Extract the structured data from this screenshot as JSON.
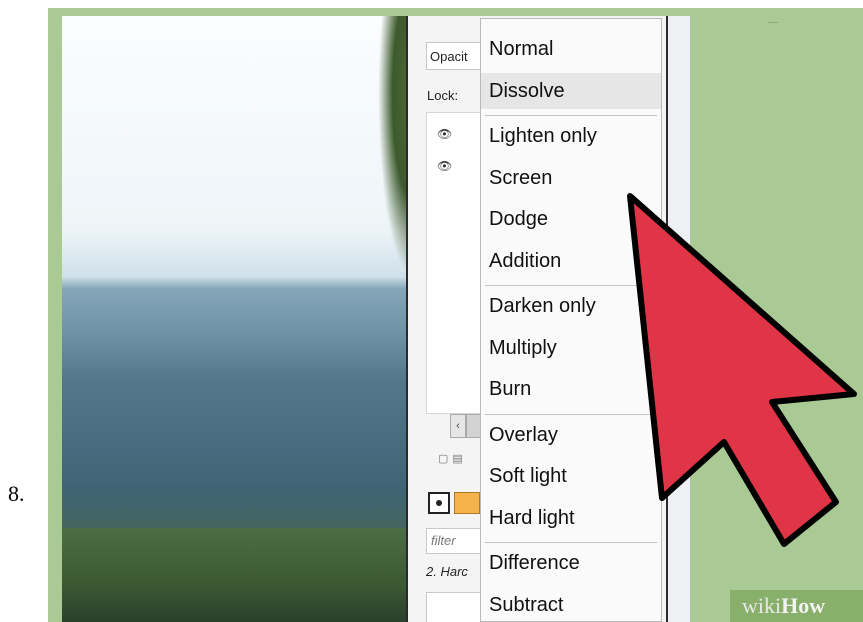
{
  "step_number": "8.",
  "layers_panel": {
    "opacity_label": "Opacit",
    "lock_label": "Lock:",
    "visibility_icons": [
      "eye-icon",
      "eye-icon"
    ],
    "filter_placeholder": "filter",
    "current_layer_name": "2. Harc",
    "fg_color": "#f6b34c",
    "scroll_left": "‹"
  },
  "blend_mode_menu": {
    "highlighted": "Dissolve",
    "groups": [
      [
        "Normal",
        "Dissolve"
      ],
      [
        "Lighten only",
        "Screen",
        "Dodge",
        "Addition"
      ],
      [
        "Darken only",
        "Multiply",
        "Burn"
      ],
      [
        "Overlay",
        "Soft light",
        "Hard light"
      ],
      [
        "Difference",
        "Subtract"
      ]
    ]
  },
  "cursor": {
    "color": "#e03546",
    "outline": "#000000",
    "icon": "arrow-cursor-icon"
  },
  "watermark": {
    "part1": "wiki",
    "part2": "How"
  },
  "colors": {
    "frame": "#a9c995",
    "panel": "#f4f4f4"
  }
}
